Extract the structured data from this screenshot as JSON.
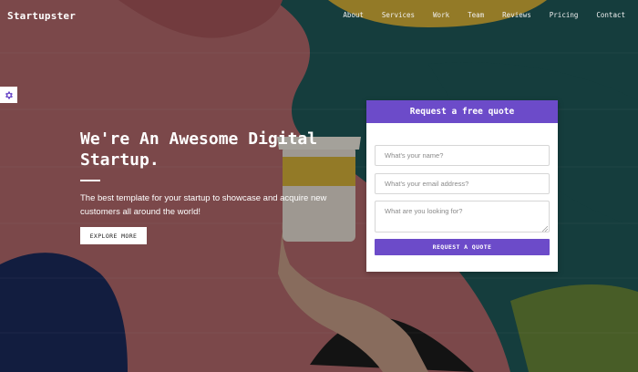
{
  "navbar": {
    "brand": "Startupster",
    "links": [
      "About",
      "Services",
      "Work",
      "Team",
      "Reviews",
      "Pricing",
      "Contact"
    ]
  },
  "settings": {
    "icon": "gear-icon"
  },
  "hero": {
    "title": "We're An Awesome Digital Startup.",
    "subtitle": "The best template for your startup to showcase and acquire new customers all around the world!",
    "cta_label": "EXPLORE MORE"
  },
  "quote_form": {
    "title": "Request a free quote",
    "name_placeholder": "What's your name?",
    "email_placeholder": "What's your email address?",
    "message_placeholder": "What are you looking for?",
    "submit_label": "REQUEST A QUOTE"
  },
  "colors": {
    "accent": "#6c4bc9",
    "mural_pink": "#b56b6e",
    "mural_teal": "#1f5a5a",
    "mural_yellow": "#d9b43a",
    "mural_navy": "#1b2b5e"
  }
}
